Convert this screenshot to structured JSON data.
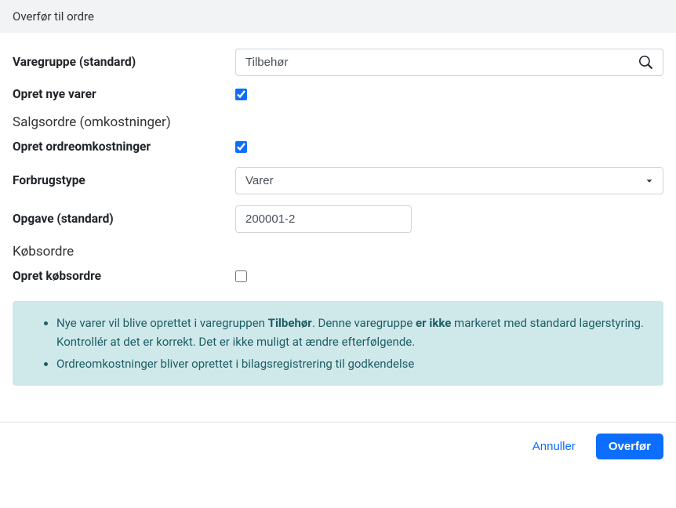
{
  "header": {
    "title": "Overfør til ordre"
  },
  "fields": {
    "varegruppe_label": "Varegruppe (standard)",
    "varegruppe_value": "Tilbehør",
    "opret_nye_varer_label": "Opret nye varer",
    "opret_ordreomkostninger_label": "Opret ordreomkostninger",
    "forbrugstype_label": "Forbrugstype",
    "forbrugstype_value": "Varer",
    "opgave_label": "Opgave (standard)",
    "opgave_value": "200001-2",
    "opret_kobsordre_label": "Opret købsordre"
  },
  "sections": {
    "salgsordre": "Salgsordre (omkostninger)",
    "kobsordre": "Købsordre"
  },
  "alert": {
    "msg1_part1": "Nye varer vil blive oprettet i varegruppen ",
    "msg1_bold1": "Tilbehør",
    "msg1_part2": ". Denne varegruppe ",
    "msg1_bold2": "er ikke",
    "msg1_part3": " markeret med standard lagerstyring. Kontrollér at det er korrekt. Det er ikke muligt at ændre efterfølgende.",
    "msg2": "Ordreomkostninger bliver oprettet i bilagsregistrering til godkendelse"
  },
  "footer": {
    "cancel": "Annuller",
    "submit": "Overfør"
  }
}
